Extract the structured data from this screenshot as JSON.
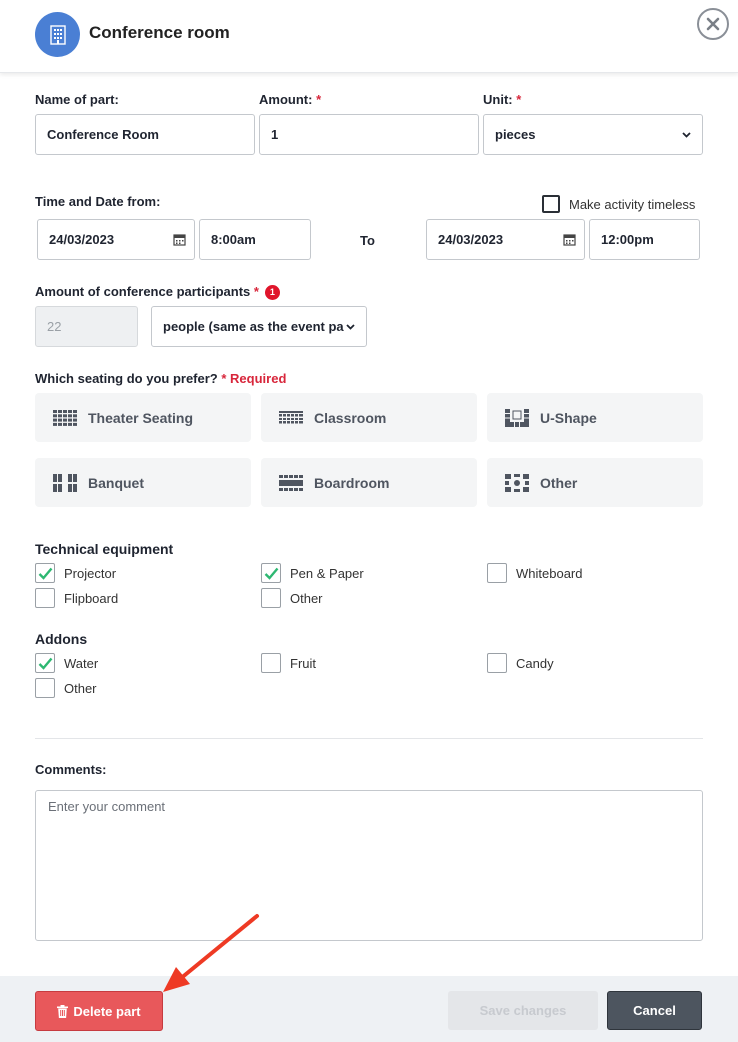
{
  "header": {
    "title": "Conference room",
    "avatar_icon": "building-icon",
    "close_icon": "close-icon"
  },
  "part": {
    "name_label": "Name of part:",
    "name_value": "Conference Room",
    "amount_label": "Amount:",
    "amount_value": "1",
    "unit_label": "Unit:",
    "unit_value": "pieces",
    "required_mark": "*"
  },
  "time": {
    "label": "Time and Date from:",
    "timeless_label": "Make activity timeless",
    "from_date": "24/03/2023",
    "from_time": "8:00am",
    "to_label": "To",
    "to_date": "24/03/2023",
    "to_time": "12:00pm"
  },
  "participants": {
    "label": "Amount of conference participants",
    "badge": "1",
    "value": "22",
    "unit_select": "people (same as the event pa"
  },
  "seating": {
    "label": "Which seating do you prefer?",
    "required_text": "* Required",
    "options": [
      {
        "label": "Theater Seating",
        "icon": "theater-seating-icon"
      },
      {
        "label": "Classroom",
        "icon": "classroom-icon"
      },
      {
        "label": "U-Shape",
        "icon": "u-shape-icon"
      },
      {
        "label": "Banquet",
        "icon": "banquet-icon"
      },
      {
        "label": "Boardroom",
        "icon": "boardroom-icon"
      },
      {
        "label": "Other",
        "icon": "other-seating-icon"
      }
    ]
  },
  "equipment": {
    "label": "Technical equipment",
    "items": [
      {
        "label": "Projector",
        "checked": true
      },
      {
        "label": "Pen & Paper",
        "checked": true
      },
      {
        "label": "Whiteboard",
        "checked": false
      },
      {
        "label": "Flipboard",
        "checked": false
      },
      {
        "label": "Other",
        "checked": false
      }
    ]
  },
  "addons": {
    "label": "Addons",
    "items": [
      {
        "label": "Water",
        "checked": true
      },
      {
        "label": "Fruit",
        "checked": false
      },
      {
        "label": "Candy",
        "checked": false
      },
      {
        "label": "Other",
        "checked": false
      }
    ]
  },
  "comments": {
    "label": "Comments:",
    "placeholder": "Enter your comment"
  },
  "footer": {
    "delete_label": "Delete part",
    "save_label": "Save changes",
    "cancel_label": "Cancel"
  },
  "colors": {
    "accent": "#4a7fd4",
    "check": "#2eb872",
    "required": "#d8263b",
    "delete": "#e8585b",
    "arrow": "#ee3a24"
  }
}
